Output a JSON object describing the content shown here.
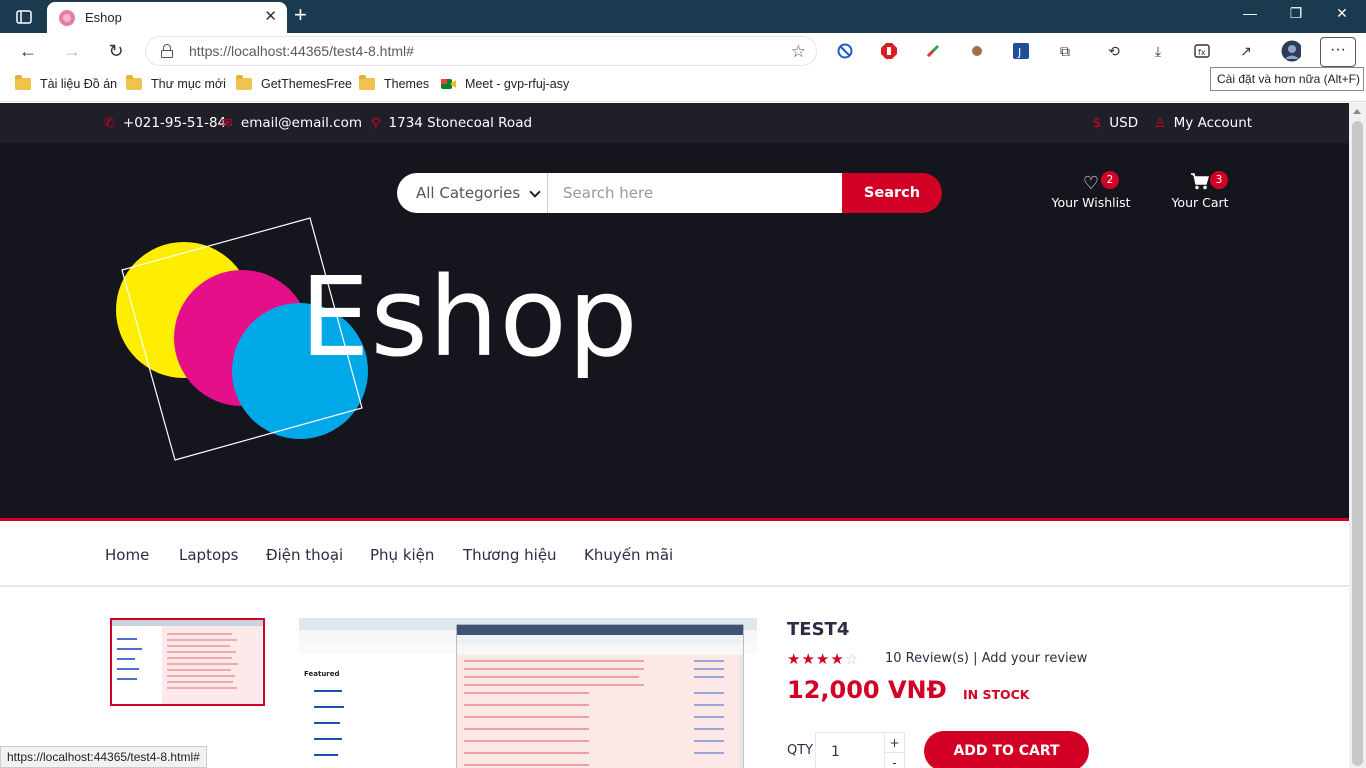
{
  "browser": {
    "tab_title": "Eshop",
    "url": "https://localhost:44365/test4-8.html#",
    "bookmarks": [
      "Tài liệu Đồ án",
      "Thư mục mới",
      "GetThemesFree",
      "Themes",
      "Meet - gvp-rfuj-asy"
    ],
    "tooltip": "Cài đặt và hơn nữa (Alt+F)",
    "status_url": "https://localhost:44365/test4-8.html#"
  },
  "topinfo": {
    "phone": "+021-95-51-84",
    "email": "email@email.com",
    "address": "1734 Stonecoal Road",
    "currency": "USD",
    "account": "My Account"
  },
  "header": {
    "category": "All Categories",
    "search_placeholder": "Search here",
    "search_button": "Search",
    "wishlist_label": "Your Wishlist",
    "wishlist_count": "2",
    "cart_label": "Your Cart",
    "cart_count": "3",
    "logo_text": "Eshop"
  },
  "nav": [
    "Home",
    "Laptops",
    "Điện thoại",
    "Phụ kiện",
    "Thương hiệu",
    "Khuyến mãi"
  ],
  "product": {
    "name": "TEST4",
    "rating": 4,
    "rating_max": 5,
    "reviews": "10 Review(s) | Add your review",
    "price": "12,000 VNĐ",
    "stock": "IN STOCK",
    "qty_label": "QTY",
    "qty_value": "1",
    "add_to_cart": "ADD TO CART"
  },
  "colors": {
    "accent": "#d10024",
    "dark": "#15161d",
    "topbar": "#1e1f29",
    "tabbar": "#1c3a4f"
  }
}
